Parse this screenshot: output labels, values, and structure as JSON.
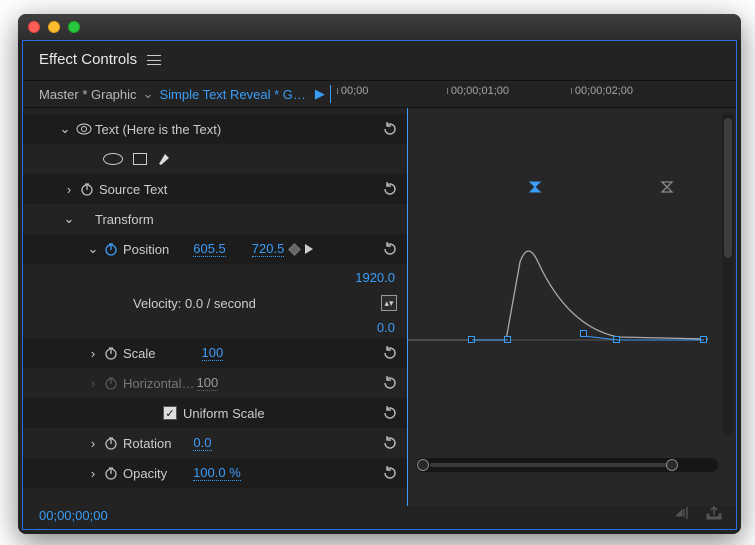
{
  "panel": {
    "title": "Effect Controls"
  },
  "bar": {
    "master": "Master * Graphic",
    "sequence": "Simple Text Reveal * G…",
    "ticks": [
      "00;00",
      "00;00;01;00",
      "00;00;02;00"
    ]
  },
  "tree": {
    "text_header": "Text (Here is the Text)",
    "source_text": "Source Text",
    "transform": "Transform",
    "position_label": "Position",
    "position_x": "605.5",
    "position_y": "720.5",
    "velocity_label": "Velocity: 0.0 / second",
    "scale_label": "Scale",
    "scale_val": "100",
    "hscale_label": "Horizontal…",
    "hscale_val": "100",
    "uniform_label": "Uniform Scale",
    "rotation_label": "Rotation",
    "rotation_val": "0.0",
    "opacity_label": "Opacity",
    "opacity_val": "100.0 %"
  },
  "graph": {
    "max": "1920.0",
    "min": "0.0"
  },
  "time": "00;00;00;00"
}
